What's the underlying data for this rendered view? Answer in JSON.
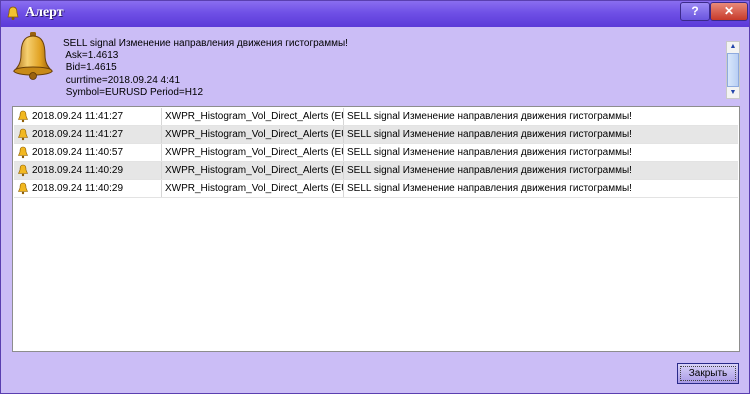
{
  "window": {
    "title": "Алерт",
    "help_label": "?",
    "close_label": "✕"
  },
  "message": {
    "lines": [
      "SELL signal Изменение направления движения гистограммы!",
      " Ask=1.4613",
      " Bid=1.4615",
      " currtime=2018.09.24 4:41",
      " Symbol=EURUSD Period=H12"
    ]
  },
  "alerts": [
    {
      "time": "2018.09.24 11:41:27",
      "source": "XWPR_Histogram_Vol_Direct_Alerts (EU...",
      "message": "SELL signal Изменение направления движения гистограммы!"
    },
    {
      "time": "2018.09.24 11:41:27",
      "source": "XWPR_Histogram_Vol_Direct_Alerts (EU...",
      "message": "SELL signal Изменение направления движения гистограммы!"
    },
    {
      "time": "2018.09.24 11:40:57",
      "source": "XWPR_Histogram_Vol_Direct_Alerts (EU...",
      "message": "SELL signal Изменение направления движения гистограммы!"
    },
    {
      "time": "2018.09.24 11:40:29",
      "source": "XWPR_Histogram_Vol_Direct_Alerts (EU...",
      "message": "SELL signal Изменение направления движения гистограммы!"
    },
    {
      "time": "2018.09.24 11:40:29",
      "source": "XWPR_Histogram_Vol_Direct_Alerts (EU...",
      "message": "SELL signal Изменение направления движения гистограммы!"
    }
  ],
  "footer": {
    "close_button_label": "Закрыть"
  },
  "icons": {
    "bell": "bell-icon",
    "app": "alert-app-icon"
  },
  "colors": {
    "title_bar": "#6f50e6",
    "window_bg": "#cbbdf6",
    "close_red": "#c73a2a",
    "bell_gold": "#e0a020"
  }
}
